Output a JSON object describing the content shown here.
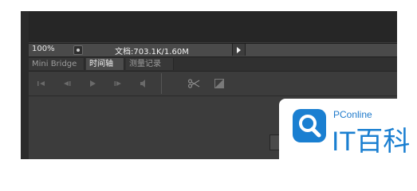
{
  "status_bar": {
    "zoom": "100%",
    "doc_info": "文档:703.1K/1.60M"
  },
  "panel": {
    "tabs": [
      {
        "label": "Mini Bridge",
        "active": false
      },
      {
        "label": "时间轴",
        "active": true
      },
      {
        "label": "测量记录",
        "active": false
      }
    ]
  },
  "toolbar": {
    "icons": [
      "first-frame-icon",
      "prev-frame-icon",
      "play-icon",
      "next-frame-icon",
      "audio-icon",
      "scissors-icon",
      "transition-icon"
    ]
  },
  "watermark": {
    "small": "PConline",
    "brand": "IT百科"
  },
  "colors": {
    "panel_bg": "#3c3c3c",
    "tab_active": "#4c4c4c",
    "brand_blue": "#1a7fd1"
  }
}
